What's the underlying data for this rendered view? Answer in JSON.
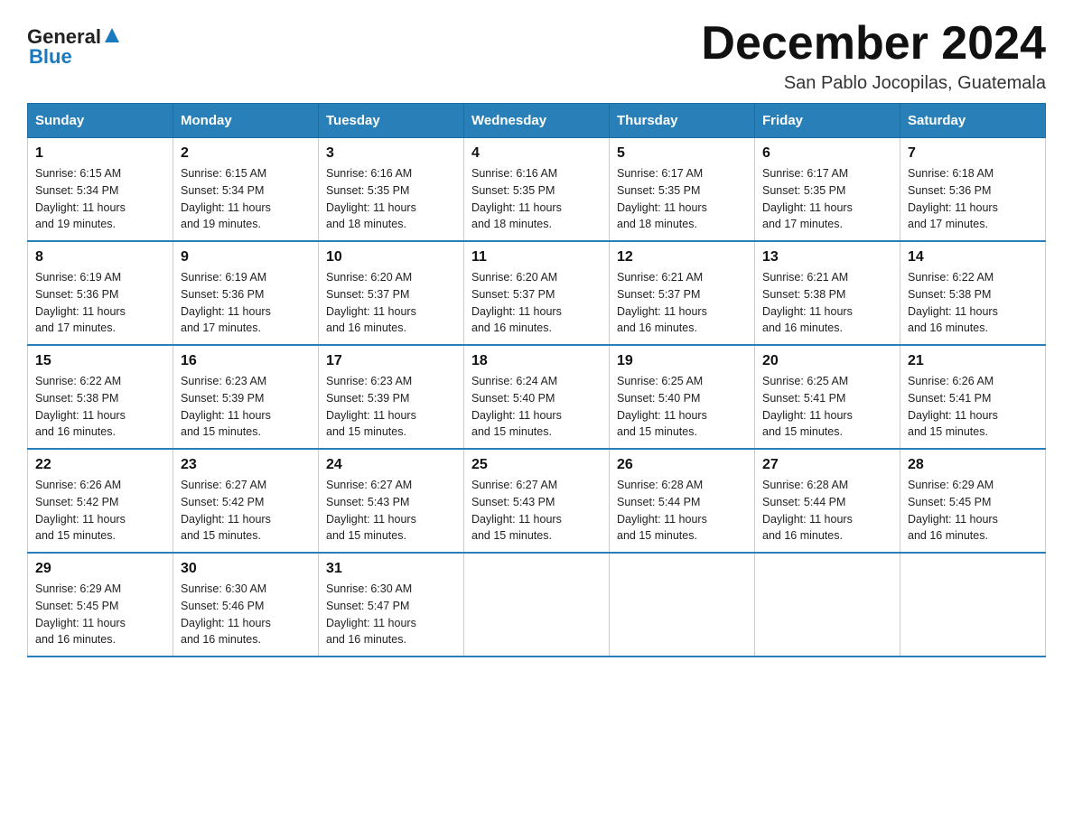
{
  "logo": {
    "text_general": "General",
    "text_blue": "Blue"
  },
  "title": "December 2024",
  "subtitle": "San Pablo Jocopilas, Guatemala",
  "weekdays": [
    "Sunday",
    "Monday",
    "Tuesday",
    "Wednesday",
    "Thursday",
    "Friday",
    "Saturday"
  ],
  "weeks": [
    [
      {
        "day": "1",
        "sunrise": "6:15 AM",
        "sunset": "5:34 PM",
        "daylight": "11 hours and 19 minutes."
      },
      {
        "day": "2",
        "sunrise": "6:15 AM",
        "sunset": "5:34 PM",
        "daylight": "11 hours and 19 minutes."
      },
      {
        "day": "3",
        "sunrise": "6:16 AM",
        "sunset": "5:35 PM",
        "daylight": "11 hours and 18 minutes."
      },
      {
        "day": "4",
        "sunrise": "6:16 AM",
        "sunset": "5:35 PM",
        "daylight": "11 hours and 18 minutes."
      },
      {
        "day": "5",
        "sunrise": "6:17 AM",
        "sunset": "5:35 PM",
        "daylight": "11 hours and 18 minutes."
      },
      {
        "day": "6",
        "sunrise": "6:17 AM",
        "sunset": "5:35 PM",
        "daylight": "11 hours and 17 minutes."
      },
      {
        "day": "7",
        "sunrise": "6:18 AM",
        "sunset": "5:36 PM",
        "daylight": "11 hours and 17 minutes."
      }
    ],
    [
      {
        "day": "8",
        "sunrise": "6:19 AM",
        "sunset": "5:36 PM",
        "daylight": "11 hours and 17 minutes."
      },
      {
        "day": "9",
        "sunrise": "6:19 AM",
        "sunset": "5:36 PM",
        "daylight": "11 hours and 17 minutes."
      },
      {
        "day": "10",
        "sunrise": "6:20 AM",
        "sunset": "5:37 PM",
        "daylight": "11 hours and 16 minutes."
      },
      {
        "day": "11",
        "sunrise": "6:20 AM",
        "sunset": "5:37 PM",
        "daylight": "11 hours and 16 minutes."
      },
      {
        "day": "12",
        "sunrise": "6:21 AM",
        "sunset": "5:37 PM",
        "daylight": "11 hours and 16 minutes."
      },
      {
        "day": "13",
        "sunrise": "6:21 AM",
        "sunset": "5:38 PM",
        "daylight": "11 hours and 16 minutes."
      },
      {
        "day": "14",
        "sunrise": "6:22 AM",
        "sunset": "5:38 PM",
        "daylight": "11 hours and 16 minutes."
      }
    ],
    [
      {
        "day": "15",
        "sunrise": "6:22 AM",
        "sunset": "5:38 PM",
        "daylight": "11 hours and 16 minutes."
      },
      {
        "day": "16",
        "sunrise": "6:23 AM",
        "sunset": "5:39 PM",
        "daylight": "11 hours and 15 minutes."
      },
      {
        "day": "17",
        "sunrise": "6:23 AM",
        "sunset": "5:39 PM",
        "daylight": "11 hours and 15 minutes."
      },
      {
        "day": "18",
        "sunrise": "6:24 AM",
        "sunset": "5:40 PM",
        "daylight": "11 hours and 15 minutes."
      },
      {
        "day": "19",
        "sunrise": "6:25 AM",
        "sunset": "5:40 PM",
        "daylight": "11 hours and 15 minutes."
      },
      {
        "day": "20",
        "sunrise": "6:25 AM",
        "sunset": "5:41 PM",
        "daylight": "11 hours and 15 minutes."
      },
      {
        "day": "21",
        "sunrise": "6:26 AM",
        "sunset": "5:41 PM",
        "daylight": "11 hours and 15 minutes."
      }
    ],
    [
      {
        "day": "22",
        "sunrise": "6:26 AM",
        "sunset": "5:42 PM",
        "daylight": "11 hours and 15 minutes."
      },
      {
        "day": "23",
        "sunrise": "6:27 AM",
        "sunset": "5:42 PM",
        "daylight": "11 hours and 15 minutes."
      },
      {
        "day": "24",
        "sunrise": "6:27 AM",
        "sunset": "5:43 PM",
        "daylight": "11 hours and 15 minutes."
      },
      {
        "day": "25",
        "sunrise": "6:27 AM",
        "sunset": "5:43 PM",
        "daylight": "11 hours and 15 minutes."
      },
      {
        "day": "26",
        "sunrise": "6:28 AM",
        "sunset": "5:44 PM",
        "daylight": "11 hours and 15 minutes."
      },
      {
        "day": "27",
        "sunrise": "6:28 AM",
        "sunset": "5:44 PM",
        "daylight": "11 hours and 16 minutes."
      },
      {
        "day": "28",
        "sunrise": "6:29 AM",
        "sunset": "5:45 PM",
        "daylight": "11 hours and 16 minutes."
      }
    ],
    [
      {
        "day": "29",
        "sunrise": "6:29 AM",
        "sunset": "5:45 PM",
        "daylight": "11 hours and 16 minutes."
      },
      {
        "day": "30",
        "sunrise": "6:30 AM",
        "sunset": "5:46 PM",
        "daylight": "11 hours and 16 minutes."
      },
      {
        "day": "31",
        "sunrise": "6:30 AM",
        "sunset": "5:47 PM",
        "daylight": "11 hours and 16 minutes."
      },
      null,
      null,
      null,
      null
    ]
  ],
  "labels": {
    "sunrise": "Sunrise:",
    "sunset": "Sunset:",
    "daylight": "Daylight:"
  }
}
